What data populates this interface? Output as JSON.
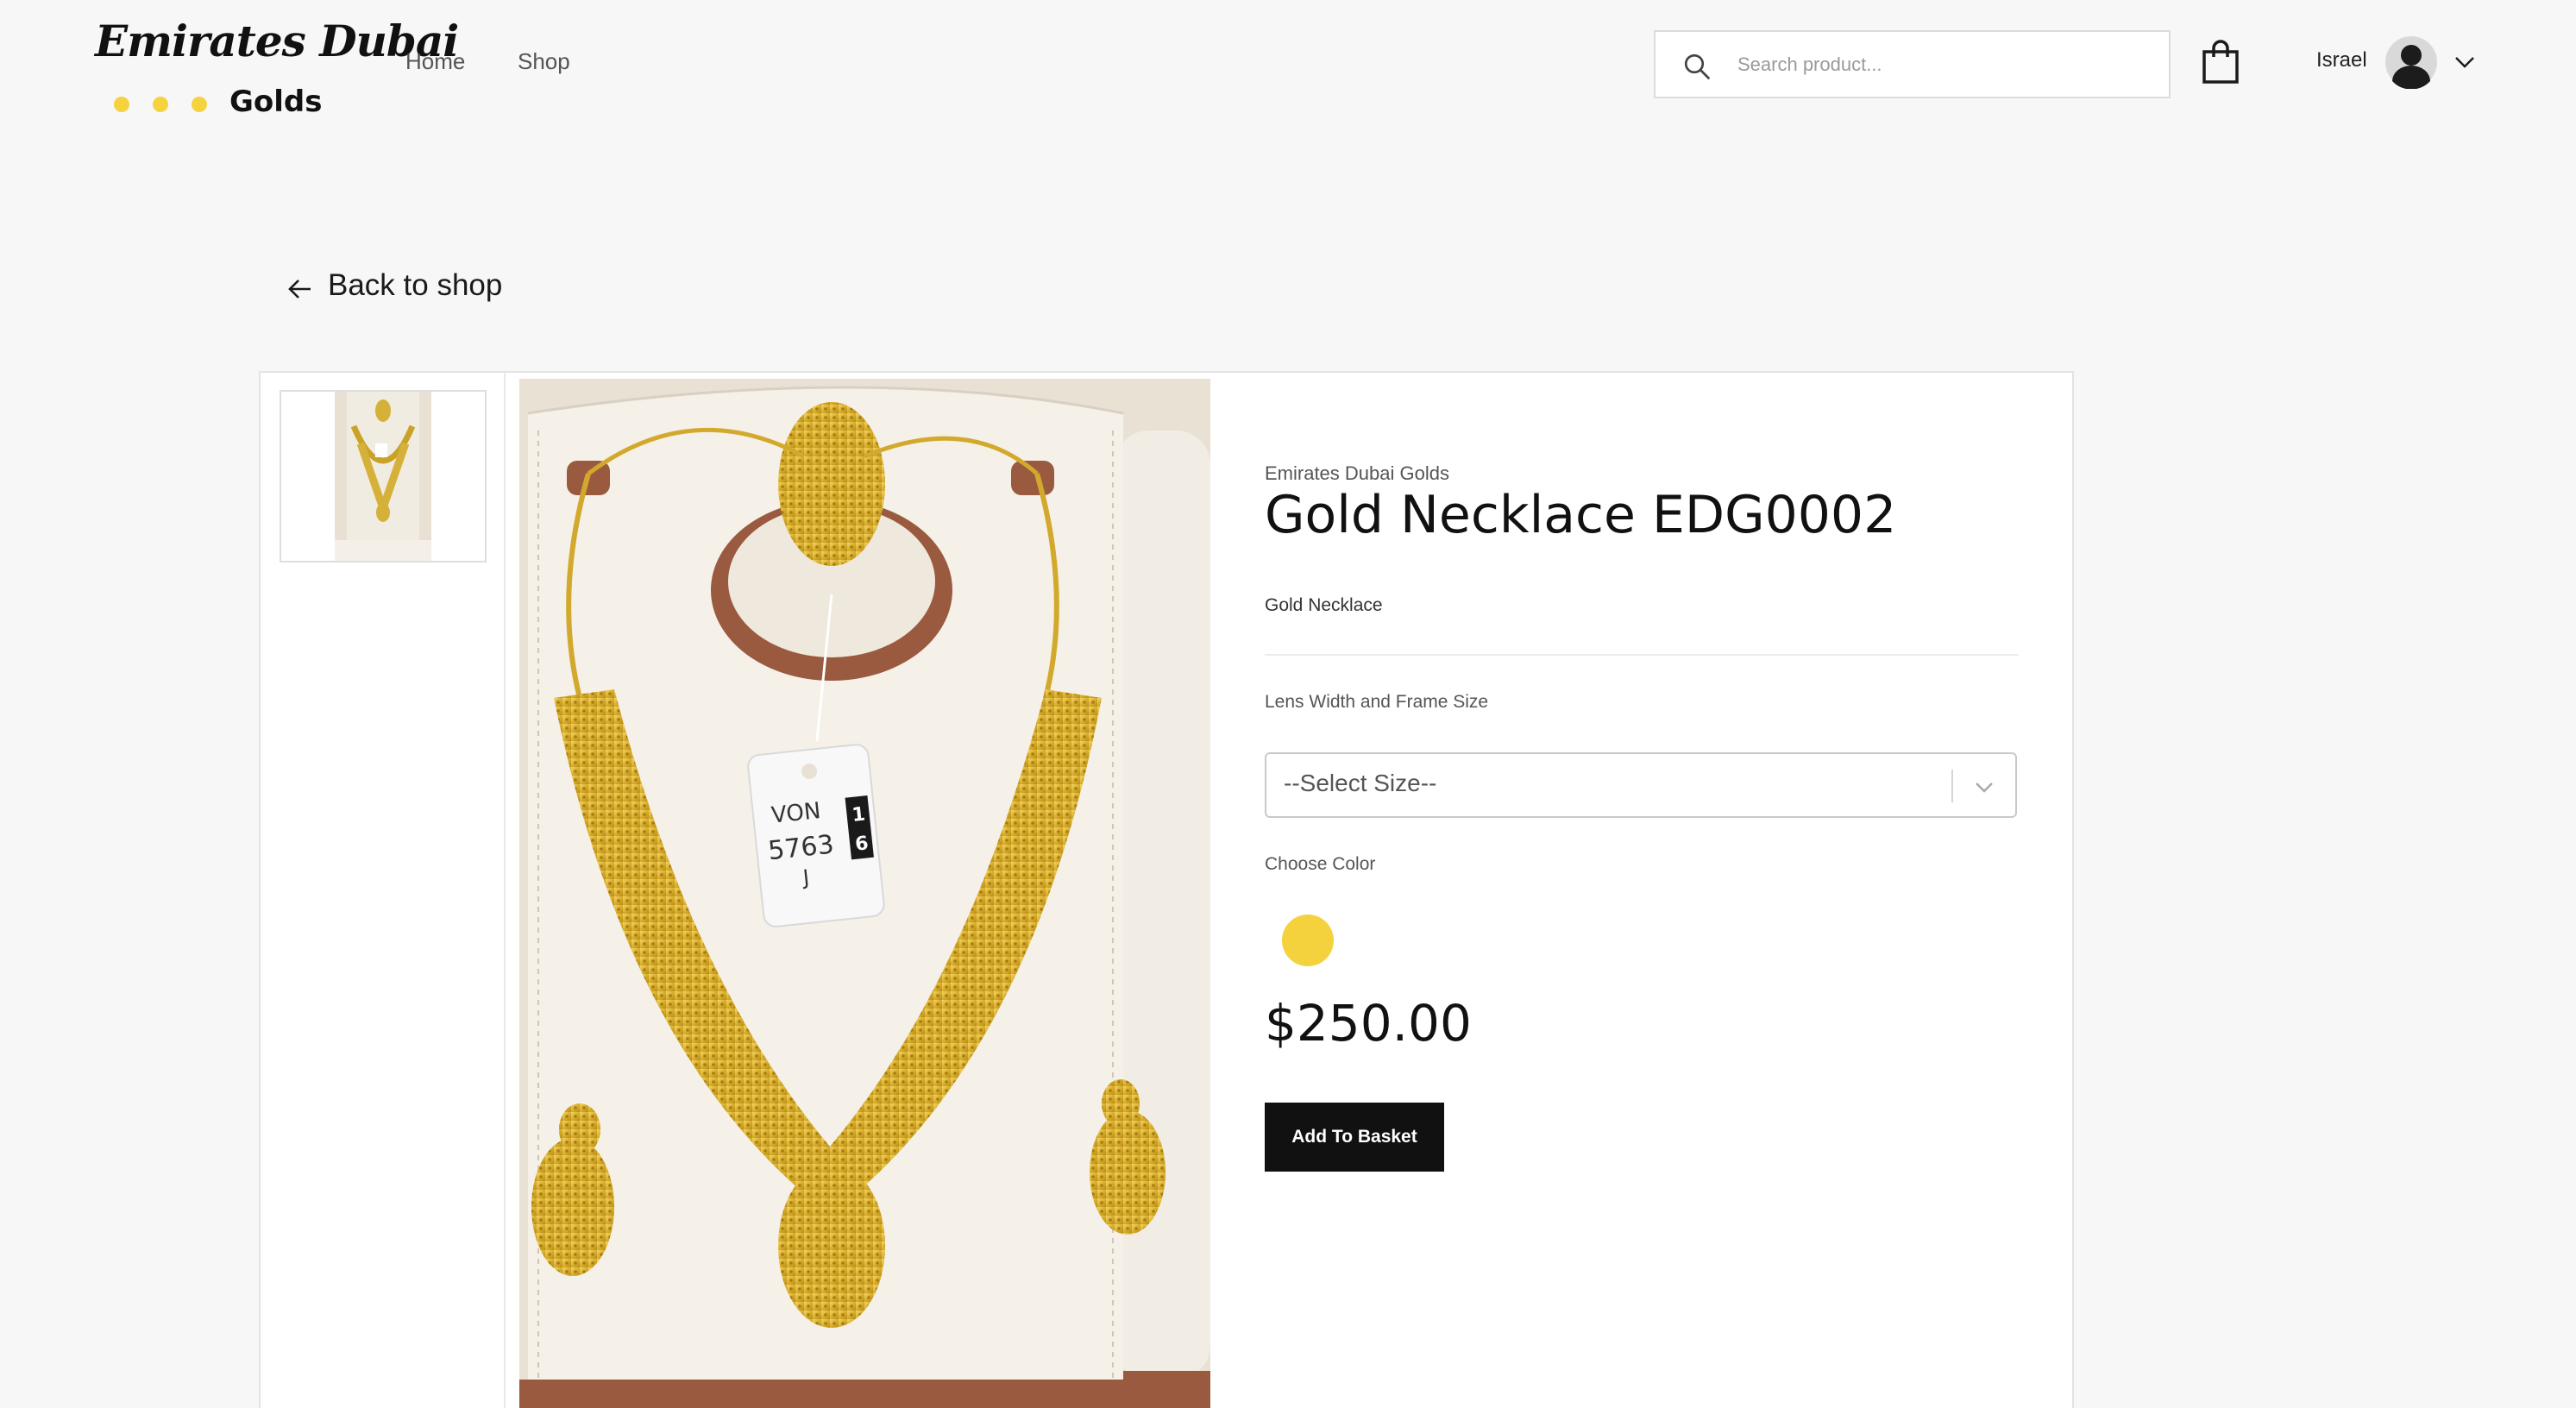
{
  "brand_logo": {
    "script_text": "Emirates Dubai",
    "sub_text": "Golds",
    "dot_color": "#f6d33e"
  },
  "nav": {
    "items": [
      {
        "label": "Home"
      },
      {
        "label": "Shop"
      }
    ]
  },
  "search": {
    "placeholder": "Search product...",
    "value": ""
  },
  "user": {
    "name": "Israel"
  },
  "back_link": {
    "label": "Back to shop"
  },
  "product": {
    "brand": "Emirates Dubai Golds",
    "title": "Gold Necklace EDG0002",
    "subtitle": "Gold Necklace",
    "size_label": "Lens Width and Frame Size",
    "size_select": {
      "selected": "--Select Size--"
    },
    "color_label": "Choose Color",
    "colors": [
      "#f4d23e"
    ],
    "price": "$250.00",
    "add_button_label": "Add To Basket",
    "tag_text": [
      "VON",
      "5763",
      "J",
      "1",
      "6"
    ]
  },
  "icons": {
    "search": "search-icon",
    "cart": "shopping-bag-icon",
    "avatar": "user-avatar-icon",
    "dropdown": "chevron-down-icon",
    "back": "arrow-left-icon"
  }
}
